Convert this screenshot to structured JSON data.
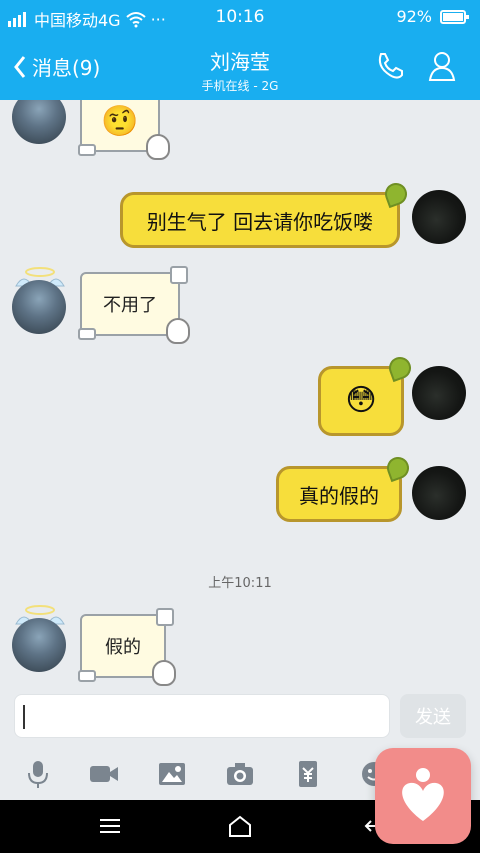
{
  "status": {
    "carrier": "中国移动4G",
    "time": "10:16",
    "battery": "92%"
  },
  "header": {
    "back_label": "消息(9)",
    "title": "刘海莹",
    "subtitle": "手机在线 - 2G"
  },
  "messages": {
    "m1_text": "别生气了 回去请你吃饭喽",
    "m2_text": "不用了",
    "m3_emoji": "😳",
    "m4_text": "真的假的",
    "timestamp": "上午10:11",
    "m5_text": "假的",
    "m0_emoji": "🤨"
  },
  "input": {
    "send_label": "发送"
  },
  "colors": {
    "header_bg": "#19aef0",
    "chat_bg": "#e9ecef",
    "bubble_yellow": "#f7de3b",
    "bubble_border": "#b8962c",
    "note_bg": "#fffbe1"
  },
  "icons": {
    "back": "chevron-left",
    "phone": "phone-icon",
    "profile": "person-icon",
    "mic": "microphone-icon",
    "video": "video-icon",
    "image": "image-icon",
    "camera": "camera-icon",
    "wallet": "red-envelope-icon",
    "emoji": "emoji-icon",
    "nav_menu": "menu-icon",
    "nav_home": "home-icon",
    "nav_back": "back-arrow-icon",
    "floating": "heart-person-icon"
  }
}
